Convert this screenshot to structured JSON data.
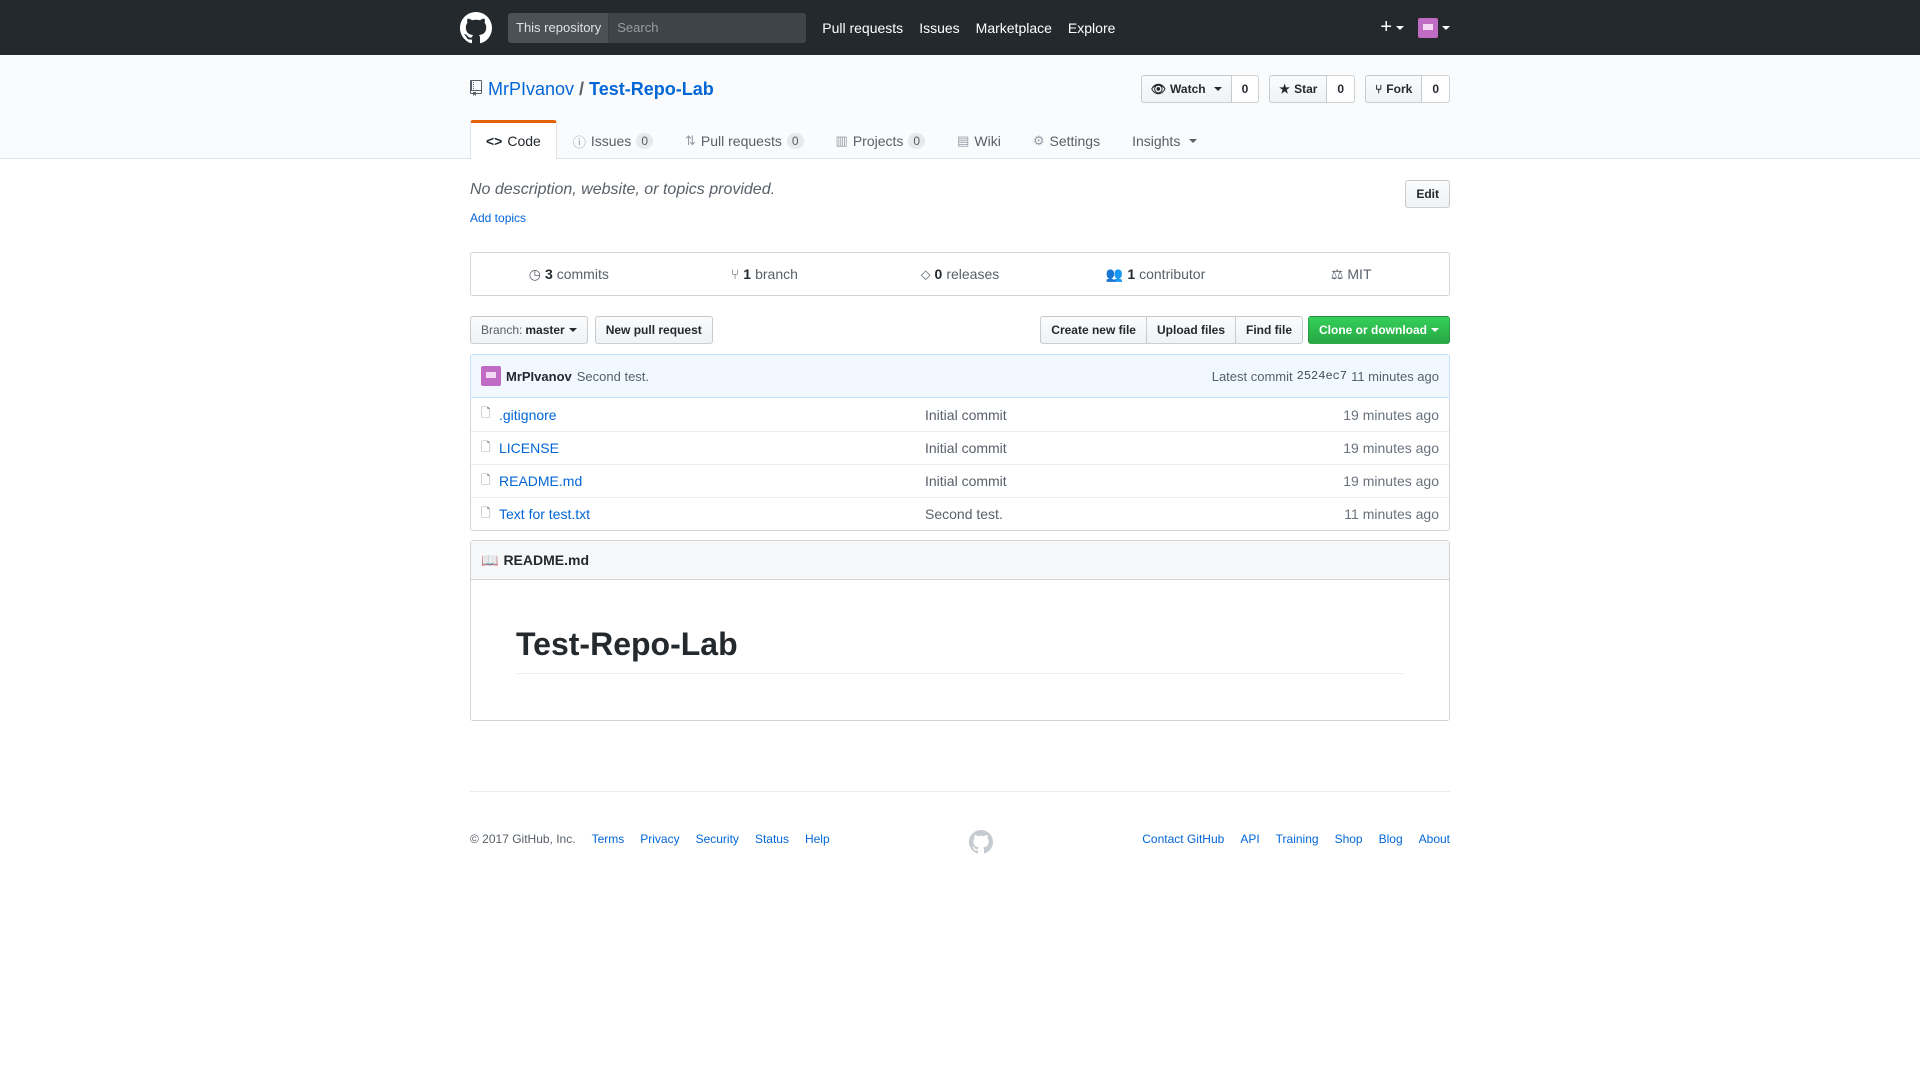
{
  "header": {
    "scope_label": "This repository",
    "search_placeholder": "Search",
    "nav": [
      "Pull requests",
      "Issues",
      "Marketplace",
      "Explore"
    ],
    "plus_icon": "plus-icon"
  },
  "repo": {
    "owner": "MrPIvanov",
    "separator": "/",
    "name": "Test-Repo-Lab",
    "watch": {
      "label": "Watch",
      "count": "0"
    },
    "star": {
      "label": "Star",
      "count": "0"
    },
    "fork": {
      "label": "Fork",
      "count": "0"
    }
  },
  "tabs": [
    {
      "label": "Code",
      "icon": "<>"
    },
    {
      "label": "Issues",
      "count": "0"
    },
    {
      "label": "Pull requests",
      "count": "0"
    },
    {
      "label": "Projects",
      "count": "0"
    },
    {
      "label": "Wiki"
    },
    {
      "label": "Settings"
    },
    {
      "label": "Insights"
    }
  ],
  "description": {
    "text": "No description, website, or topics provided.",
    "add_topics": "Add topics",
    "edit": "Edit"
  },
  "summary": {
    "commits_num": "3",
    "commits_label": "commits",
    "branch_num": "1",
    "branch_label": "branch",
    "releases_num": "0",
    "releases_label": "releases",
    "contributor_num": "1",
    "contributor_label": "contributor",
    "license": "MIT"
  },
  "file_nav": {
    "branch_prefix": "Branch:",
    "branch_name": "master",
    "new_pr": "New pull request",
    "create_file": "Create new file",
    "upload_files": "Upload files",
    "find_file": "Find file",
    "clone": "Clone or download"
  },
  "latest_commit": {
    "author": "MrPIvanov",
    "message": "Second test.",
    "label": "Latest commit",
    "sha": "2524ec7",
    "age": "11 minutes ago"
  },
  "files": [
    {
      "name": ".gitignore",
      "message": "Initial commit",
      "age": "19 minutes ago"
    },
    {
      "name": "LICENSE",
      "message": "Initial commit",
      "age": "19 minutes ago"
    },
    {
      "name": "README.md",
      "message": "Initial commit",
      "age": "19 minutes ago"
    },
    {
      "name": "Text for test.txt",
      "message": "Second test.",
      "age": "11 minutes ago"
    }
  ],
  "readme": {
    "filename": "README.md",
    "heading": "Test-Repo-Lab"
  },
  "footer": {
    "copyright": "© 2017 GitHub, Inc.",
    "left_links": [
      "Terms",
      "Privacy",
      "Security",
      "Status",
      "Help"
    ],
    "right_links": [
      "Contact GitHub",
      "API",
      "Training",
      "Shop",
      "Blog",
      "About"
    ]
  },
  "colors": {
    "header_bg": "#24292e",
    "link": "#0366d6",
    "accent_tab": "#e36209",
    "clone_green": "#28a745"
  }
}
